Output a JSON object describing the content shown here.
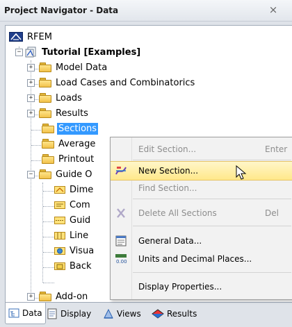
{
  "window": {
    "title": "Project Navigator - Data",
    "close_glyph": "×"
  },
  "tree": {
    "root": "RFEM",
    "project": "Tutorial [Examples]",
    "items": [
      "Model Data",
      "Load Cases and Combinatorics",
      "Loads",
      "Results",
      "Sections",
      "Average",
      "Printout",
      "Guide O",
      "Dime",
      "Com",
      "Guid",
      "Line",
      "Visua",
      "Back",
      "Add-on"
    ]
  },
  "context_menu": {
    "items": [
      {
        "label": "Edit Section...",
        "shortcut": "Enter",
        "enabled": false
      },
      {
        "label": "New Section...",
        "shortcut": "",
        "enabled": true,
        "highlighted": true
      },
      {
        "label": "Find Section...",
        "shortcut": "",
        "enabled": false
      },
      {
        "label": "Delete All Sections",
        "shortcut": "Del",
        "enabled": false
      },
      {
        "label": "General Data...",
        "shortcut": "",
        "enabled": true
      },
      {
        "label": "Units and Decimal Places...",
        "shortcut": "",
        "enabled": true
      },
      {
        "label": "Display Properties...",
        "shortcut": "",
        "enabled": true
      }
    ],
    "units_icon_text": "0.00"
  },
  "tabs": [
    {
      "label": "Data",
      "active": true
    },
    {
      "label": "Display",
      "active": false
    },
    {
      "label": "Views",
      "active": false
    },
    {
      "label": "Results",
      "active": false
    }
  ],
  "colors": {
    "selection": "#3399ff",
    "menu_highlight": "#ffe88a",
    "folder": "#f2c24b"
  }
}
